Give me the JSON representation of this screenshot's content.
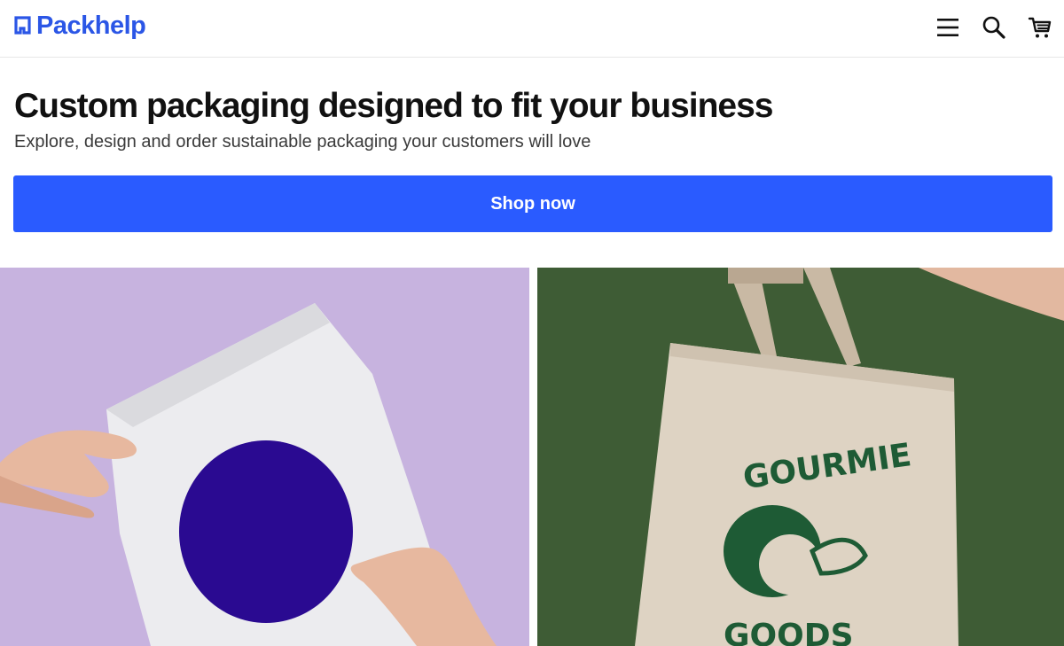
{
  "header": {
    "logo_text": "Packhelp",
    "brand_color": "#2b56e6",
    "icons": [
      "menu-icon",
      "search-icon",
      "cart-icon"
    ]
  },
  "hero": {
    "title": "Custom packaging designed to fit your business",
    "subtitle": "Explore, design and order sustainable packaging your customers will love",
    "cta_label": "Shop now",
    "cta_color": "#2a5bff"
  },
  "tiles": [
    {
      "name": "mailer-bag-photo",
      "background": "#c7b3df"
    },
    {
      "name": "tote-bag-photo",
      "background": "#3e5c35",
      "print_text_top": "GOURMIE",
      "print_text_bottom": "GOODS"
    }
  ]
}
